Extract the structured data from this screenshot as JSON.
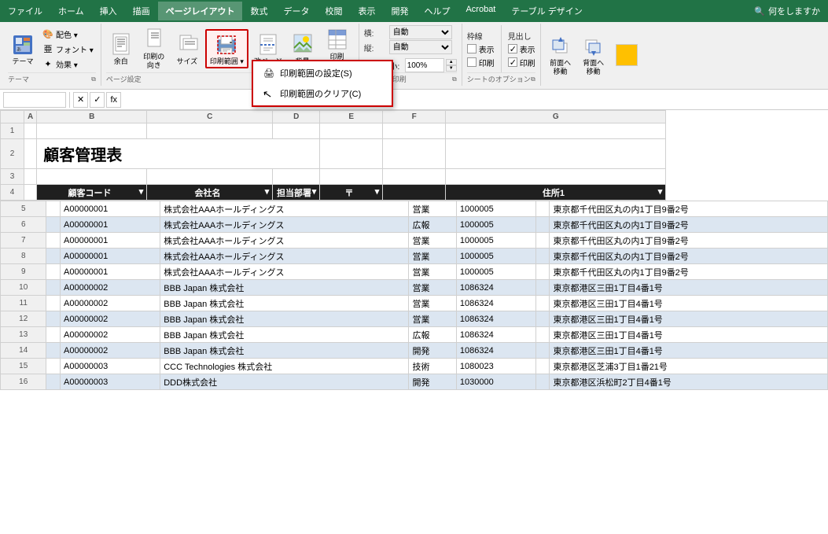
{
  "menubar": {
    "items": [
      "ファイル",
      "ホーム",
      "挿入",
      "描画",
      "ページレイアウト",
      "数式",
      "データ",
      "校閲",
      "表示",
      "開発",
      "ヘルプ",
      "Acrobat",
      "テーブル デザイン"
    ]
  },
  "ribbon": {
    "active_tab": "ページレイアウト",
    "groups": {
      "theme": {
        "label": "テーマ",
        "buttons": [
          {
            "id": "theme-btn",
            "label": "テーマ"
          },
          {
            "id": "colors-btn",
            "label": "配色"
          },
          {
            "id": "fonts-btn",
            "label": "フォント"
          },
          {
            "id": "effects-btn",
            "label": "効果"
          }
        ]
      },
      "page_setup": {
        "label": "ページ設定",
        "buttons": [
          {
            "id": "margins-btn",
            "label": "余白"
          },
          {
            "id": "orientation-btn",
            "label": "印刷の\n向き"
          },
          {
            "id": "size-btn",
            "label": "サイズ"
          },
          {
            "id": "print-area-btn",
            "label": "印刷範囲"
          },
          {
            "id": "breaks-btn",
            "label": "改ページ"
          },
          {
            "id": "background-btn",
            "label": "背景"
          },
          {
            "id": "print-titles-btn",
            "label": "印刷\nタイトル"
          }
        ]
      }
    },
    "scale_section": {
      "label": "拡大縮小印刷",
      "width_label": "横:",
      "height_label": "縦:",
      "width_value": "自動",
      "height_value": "自動",
      "scale_label": "拡大/縮小:",
      "scale_value": "100%"
    },
    "sheet_options": {
      "label": "シートのオプション",
      "gridlines": {
        "label": "枠線",
        "view": {
          "label": "表示",
          "checked": false
        },
        "print": {
          "label": "印刷",
          "checked": false
        }
      },
      "headings": {
        "label": "見出し",
        "view": {
          "label": "表示",
          "checked": true
        },
        "print": {
          "label": "印刷",
          "checked": true
        }
      }
    },
    "arrange": {
      "label": "",
      "front_label": "前面へ\n移動",
      "back_label": "背面へ\n移動",
      "color_label": ""
    }
  },
  "dropdown_menu": {
    "items": [
      {
        "id": "set-print-area",
        "label": "印刷範囲の設定(S)"
      },
      {
        "id": "clear-print-area",
        "label": "印刷範囲のクリア(C)"
      }
    ]
  },
  "formula_bar": {
    "name_box": "",
    "cancel_btn": "✕",
    "confirm_btn": "✓",
    "fx_btn": "fx",
    "formula": ""
  },
  "spreadsheet": {
    "col_headers": [
      "A",
      "B",
      "C",
      "D",
      "E",
      "F",
      "G"
    ],
    "row_headers": [
      "1",
      "2",
      "3",
      "4",
      "5",
      "6",
      "7",
      "8",
      "9",
      "10",
      "11",
      "12",
      "13",
      "14",
      "15",
      "16"
    ],
    "title_cell": "顧客管理表",
    "headers": [
      "顧客コード",
      "会社名",
      "担当部署",
      "〒",
      "住所1"
    ],
    "rows": [
      [
        "A00000001",
        "株式会社AAAホールディングス",
        "営業",
        "1000005",
        "東京都千代田区丸の内1丁目9番2号"
      ],
      [
        "A00000001",
        "株式会社AAAホールディングス",
        "広報",
        "1000005",
        "東京都千代田区丸の内1丁目9番2号"
      ],
      [
        "A00000001",
        "株式会社AAAホールディングス",
        "営業",
        "1000005",
        "東京都千代田区丸の内1丁目9番2号"
      ],
      [
        "A00000001",
        "株式会社AAAホールディングス",
        "営業",
        "1000005",
        "東京都千代田区丸の内1丁目9番2号"
      ],
      [
        "A00000001",
        "株式会社AAAホールディングス",
        "営業",
        "1000005",
        "東京都千代田区丸の内1丁目9番2号"
      ],
      [
        "A00000002",
        "BBB Japan 株式会社",
        "営業",
        "1086324",
        "東京都港区三田1丁目4番1号"
      ],
      [
        "A00000002",
        "BBB Japan 株式会社",
        "営業",
        "1086324",
        "東京都港区三田1丁目4番1号"
      ],
      [
        "A00000002",
        "BBB Japan 株式会社",
        "営業",
        "1086324",
        "東京都港区三田1丁目4番1号"
      ],
      [
        "A00000002",
        "BBB Japan 株式会社",
        "広報",
        "1086324",
        "東京都港区三田1丁目4番1号"
      ],
      [
        "A00000002",
        "BBB Japan 株式会社",
        "開発",
        "1086324",
        "東京都港区三田1丁目4番1号"
      ],
      [
        "A00000003",
        "CCC Technologies 株式会社",
        "技術",
        "1080023",
        "東京都港区芝浦3丁目1番21号"
      ],
      [
        "A00000003",
        "DDD株式会社",
        "開発",
        "1030000",
        "東京都港区浜松町2丁目4番1号"
      ]
    ]
  },
  "search_btn": "何をしますか"
}
